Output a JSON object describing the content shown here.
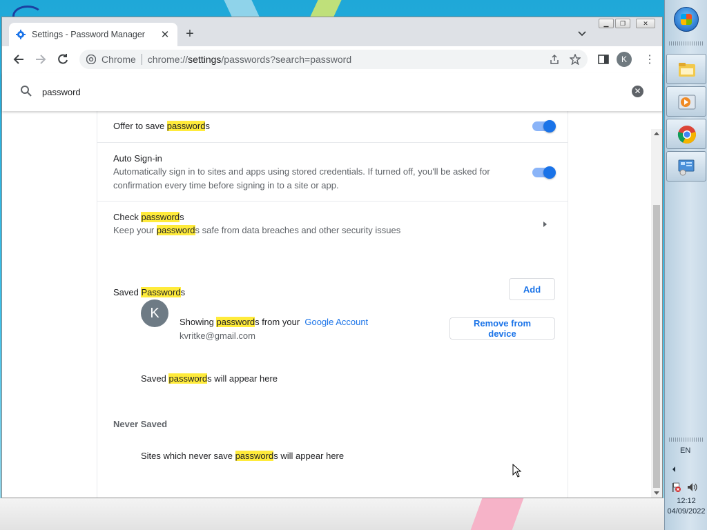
{
  "browser": {
    "tab_title": "Settings - Password Manager",
    "omnibox_chip": "Chrome",
    "url_prefix": "chrome://",
    "url_host": "settings",
    "url_rest": "/passwords?search=password",
    "profile_initial": "K"
  },
  "search": {
    "value": "password"
  },
  "settings": {
    "offer_save": {
      "prefix": "Offer to save ",
      "hl": "password",
      "suffix": "s",
      "enabled": true
    },
    "auto_signin": {
      "title": "Auto Sign-in",
      "description": "Automatically sign in to sites and apps using stored credentials. If turned off, you'll be asked for confirmation every time before signing in to a site or app.",
      "enabled": true
    },
    "check": {
      "title_prefix": "Check ",
      "title_hl": "password",
      "title_suffix": "s",
      "desc_prefix": "Keep your ",
      "desc_hl": "password",
      "desc_suffix": "s safe from data breaches and other security issues"
    },
    "saved": {
      "heading_prefix": "Saved ",
      "heading_hl": "Password",
      "heading_suffix": "s",
      "add_label": "Add",
      "account_initial": "K",
      "showing_prefix": "Showing ",
      "showing_hl": "password",
      "showing_suffix": "s from your",
      "account_link": "Google Account",
      "email": "kvritke@gmail.com",
      "remove_label": "Remove from device",
      "empty_prefix": "Saved ",
      "empty_hl": "password",
      "empty_suffix": "s will appear here"
    },
    "never": {
      "heading": "Never Saved",
      "empty_prefix": "Sites which never save ",
      "empty_hl": "password",
      "empty_suffix": "s will appear here"
    }
  },
  "taskbar": {
    "language": "EN",
    "time": "12:12",
    "date": "04/09/2022",
    "pinned": [
      "file-explorer-icon",
      "media-player-icon",
      "chrome-icon",
      "control-panel-icon"
    ]
  },
  "colors": {
    "accent": "#1a73e8",
    "highlight": "#ffeb3b",
    "toggle_track": "#8ab4f8"
  }
}
